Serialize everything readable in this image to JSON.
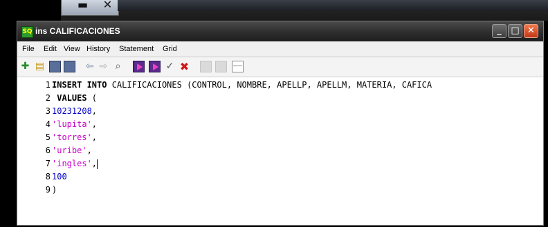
{
  "background_window": {
    "caption_buttons": "▬ ✕"
  },
  "window": {
    "title": "ins CALIFICACIONES",
    "app_icon_glyph": "SQ",
    "minimize_glyph": "_",
    "maximize_glyph": "□",
    "close_glyph": "✕"
  },
  "menu": {
    "items": [
      "File",
      "Edit",
      "View",
      "History",
      "Statement",
      "Grid"
    ]
  },
  "toolbar": {
    "icons": [
      "new-icon",
      "open-icon",
      "save-icon",
      "save-as-icon",
      "back-arrow-icon",
      "forward-arrow-icon",
      "find-icon",
      "execute-icon",
      "execute-all-icon",
      "check-icon",
      "cancel-icon",
      "disabled-icon",
      "disabled-icon",
      "grid-icon"
    ],
    "glyphs": {
      "new": "✚",
      "open": "▤",
      "back": "⇦",
      "forward": "⇨",
      "find": "⌕",
      "check": "✓",
      "cancel": "✖"
    }
  },
  "editor": {
    "lines": [
      {
        "number": "1",
        "parts": [
          {
            "text": "INSERT INTO",
            "kind": "kw"
          },
          {
            "text": " CALIFICACIONES (CONTROL, NOMBRE, APELLP, APELLM, MATERIA, CAFICA",
            "kind": "plain"
          }
        ]
      },
      {
        "number": "2",
        "parts": [
          {
            "text": " VALUES",
            "kind": "kw"
          },
          {
            "text": " (",
            "kind": "plain"
          }
        ]
      },
      {
        "number": "3",
        "parts": [
          {
            "text": "10231208",
            "kind": "num"
          },
          {
            "text": ",",
            "kind": "plain"
          }
        ]
      },
      {
        "number": "4",
        "parts": [
          {
            "text": "'lupita'",
            "kind": "str"
          },
          {
            "text": ",",
            "kind": "plain"
          }
        ]
      },
      {
        "number": "5",
        "parts": [
          {
            "text": "'torres'",
            "kind": "str"
          },
          {
            "text": ",",
            "kind": "plain"
          }
        ]
      },
      {
        "number": "6",
        "parts": [
          {
            "text": "'uribe'",
            "kind": "str"
          },
          {
            "text": ",",
            "kind": "plain"
          }
        ]
      },
      {
        "number": "7",
        "parts": [
          {
            "text": "'ingles'",
            "kind": "str"
          },
          {
            "text": ",",
            "kind": "plain"
          }
        ]
      },
      {
        "number": "8",
        "parts": [
          {
            "text": "100",
            "kind": "num"
          }
        ]
      },
      {
        "number": "9",
        "parts": [
          {
            "text": ")",
            "kind": "plain"
          }
        ]
      }
    ]
  },
  "colors": {
    "keyword": "#000000",
    "number": "#0000c8",
    "string": "#c800c8",
    "titlebar": "#2e2e2e",
    "close_button": "#d9481f"
  }
}
